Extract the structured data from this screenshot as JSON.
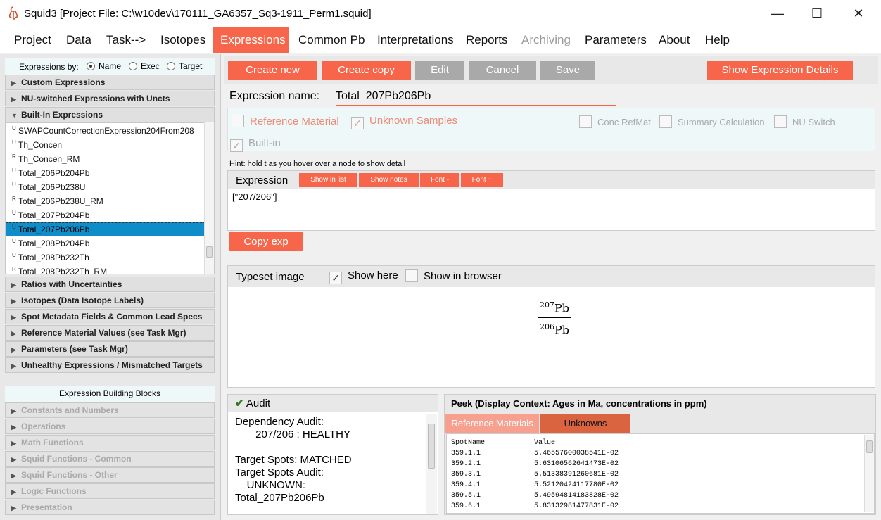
{
  "window": {
    "title": "Squid3  [Project File: C:\\w10dev\\170111_GA6357_Sq3-1911_Perm1.squid]",
    "minimize": "—",
    "maximize": "☐",
    "close": "✕"
  },
  "menu": [
    {
      "label": "Project"
    },
    {
      "label": "Data"
    },
    {
      "label": "Task-->"
    },
    {
      "label": "Isotopes"
    },
    {
      "label": "Expressions"
    },
    {
      "label": "Common Pb"
    },
    {
      "label": "Interpretations"
    },
    {
      "label": "Reports"
    },
    {
      "label": "Archiving"
    },
    {
      "label": "Parameters"
    },
    {
      "label": "About"
    },
    {
      "label": "Help"
    }
  ],
  "left": {
    "expressions_by": {
      "label": "Expressions by:",
      "options": [
        "Name",
        "Exec",
        "Target"
      ],
      "selected": "Name"
    },
    "sections_top": [
      "Custom Expressions",
      "NU-switched Expressions with Uncts",
      "Built-In Expressions"
    ],
    "list": [
      {
        "tag": "U",
        "name": "SWAPCountCorrectionExpression204From208"
      },
      {
        "tag": "U",
        "name": "Th_Concen"
      },
      {
        "tag": "R",
        "name": "Th_Concen_RM"
      },
      {
        "tag": "U",
        "name": "Total_206Pb204Pb"
      },
      {
        "tag": "U",
        "name": "Total_206Pb238U"
      },
      {
        "tag": "R",
        "name": "Total_206Pb238U_RM"
      },
      {
        "tag": "U",
        "name": "Total_207Pb204Pb"
      },
      {
        "tag": "U",
        "name": "Total_207Pb206Pb"
      },
      {
        "tag": "U",
        "name": "Total_208Pb204Pb"
      },
      {
        "tag": "U",
        "name": "Total_208Pb232Th"
      },
      {
        "tag": "R",
        "name": "Total_208Pb232Th_RM"
      }
    ],
    "selected_index": 7,
    "sections_bottom": [
      "Ratios with Uncertainties",
      "Isotopes (Data Isotope Labels)",
      "Spot Metadata Fields & Common Lead Specs",
      "Reference Material Values (see Task Mgr)",
      "Parameters (see Task Mgr)",
      "Unhealthy Expressions / Mismatched Targets"
    ],
    "building_blocks_title": "Expression Building Blocks",
    "building_blocks": [
      "Constants and Numbers",
      "Operations",
      "Math Functions",
      "Squid Functions - Common",
      "Squid Functions - Other",
      "Logic Functions",
      "Presentation"
    ]
  },
  "toolbar": {
    "create_new": "Create new",
    "create_copy": "Create copy",
    "edit": "Edit",
    "cancel": "Cancel",
    "save": "Save",
    "show_details": "Show Expression Details"
  },
  "editor": {
    "name_label": "Expression name:",
    "name_value": "Total_207Pb206Pb",
    "flags": {
      "reference_material": "Reference Material",
      "unknown_samples": "Unknown Samples",
      "conc_refmat": "Conc RefMat",
      "summary_calculation": "Summary Calculation",
      "nu_switch": "NU Switch",
      "built_in": "Built-in"
    },
    "hint": "Hint: hold t as you hover over a node to show detail",
    "expression_label": "Expression",
    "show_in_list": "Show in list",
    "show_notes": "Show notes",
    "font_minus": "Font -",
    "font_plus": "Font +",
    "expression_text": "[\"207/206\"]",
    "copy_exp": "Copy exp"
  },
  "typeset": {
    "label": "Typeset image",
    "show_here": "Show here",
    "show_in_browser": "Show in browser",
    "num_sup": "207",
    "num_el": "Pb",
    "den_sup": "206",
    "den_el": "Pb"
  },
  "audit": {
    "title": "Audit",
    "lines": "Dependency Audit:\n       207/206 : HEALTHY\n\nTarget Spots: MATCHED\nTarget Spots Audit:\n    UNKNOWN:\nTotal_207Pb206Pb"
  },
  "peek": {
    "title": "Peek (Display Context: Ages in Ma, concentrations in ppm)",
    "tab_ref": "Reference Materials",
    "tab_unk": "Unknowns",
    "col_spot": "SpotName",
    "col_value": "Value",
    "rows": [
      {
        "spot": "359.1.1",
        "value": "5.46557600038541E-02"
      },
      {
        "spot": "359.2.1",
        "value": "5.63106562641473E-02"
      },
      {
        "spot": "359.3.1",
        "value": "5.51338391260681E-02"
      },
      {
        "spot": "359.4.1",
        "value": "5.52120424117780E-02"
      },
      {
        "spot": "359.5.1",
        "value": "5.49594814183828E-02"
      },
      {
        "spot": "359.6.1",
        "value": "5.83132981477831E-02"
      }
    ]
  },
  "colors": {
    "accent": "#f7664a",
    "selection": "#0f8dc9",
    "panel_tint": "#eef8f8"
  }
}
